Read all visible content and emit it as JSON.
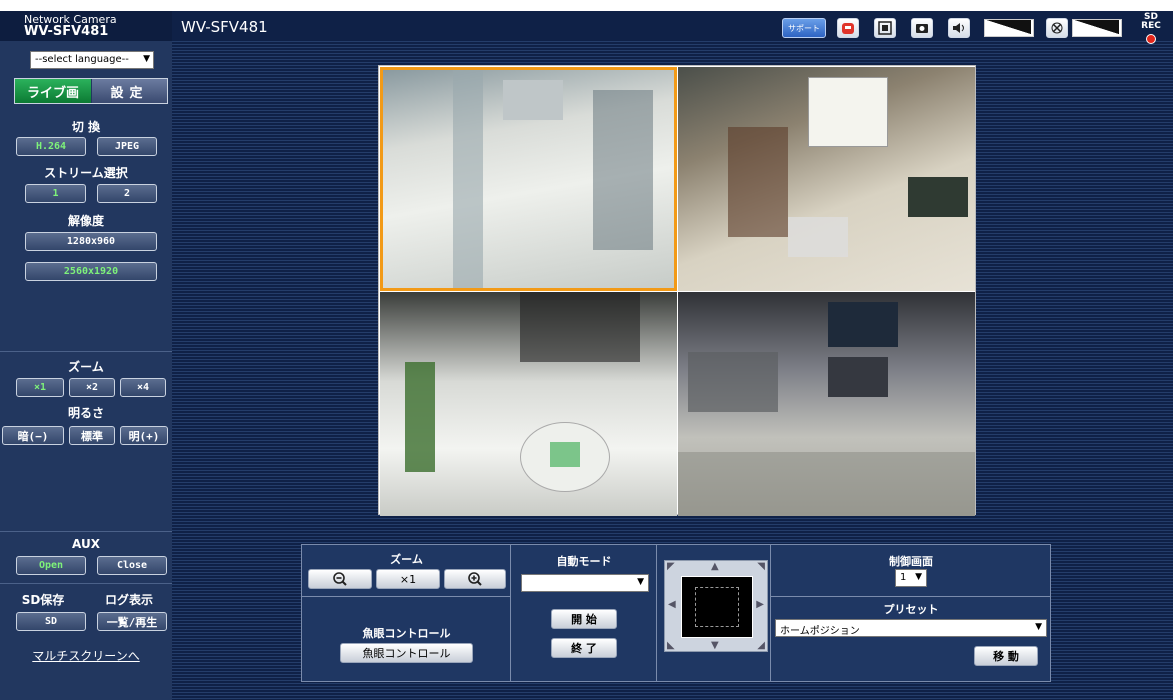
{
  "header": {
    "brand_line1": "Network Camera",
    "brand_line2": "WV-SFV481",
    "model": "WV-SFV481",
    "support_label": "サポート",
    "sd_rec_label": "SD REC"
  },
  "sidebar": {
    "language_select": "--select language--",
    "tab_live": "ライブ画",
    "tab_settings": "設定",
    "switch_label": "切 換",
    "codec_h264": "H.264",
    "codec_jpeg": "JPEG",
    "stream_label": "ストリーム選択",
    "stream_1": "1",
    "stream_2": "2",
    "resolution_label": "解像度",
    "res_1": "1280x960",
    "res_2": "2560x1920",
    "zoom_label": "ズーム",
    "zoom_x1": "×1",
    "zoom_x2": "×2",
    "zoom_x4": "×4",
    "brightness_label": "明るさ",
    "bright_dark": "暗(−)",
    "bright_std": "標準",
    "bright_light": "明(+)",
    "aux_label": "AUX",
    "aux_open": "Open",
    "aux_close": "Close",
    "sd_save_label": "SD保存",
    "log_label": "ログ表示",
    "sd_btn": "SD",
    "list_play_btn": "一覧/再生",
    "multiscreen_link": "マルチスクリーンへ"
  },
  "control": {
    "zoom_label": "ズーム",
    "zoom_x1": "×1",
    "fisheye_label": "魚眼コントロール",
    "fisheye_btn": "魚眼コントロール",
    "auto_mode_label": "自動モード",
    "auto_mode_value": "",
    "start_btn": "開 始",
    "stop_btn": "終 了",
    "control_screen_label": "制御画面",
    "control_screen_value": "1",
    "preset_label": "プリセット",
    "preset_value": "ホームポジション",
    "move_btn": "移 動"
  },
  "colors": {
    "accent_orange": "#f29a17",
    "active_green": "#7ef27a",
    "tab_green": "#0c7a33",
    "sd_rec_red": "#e3261b"
  }
}
